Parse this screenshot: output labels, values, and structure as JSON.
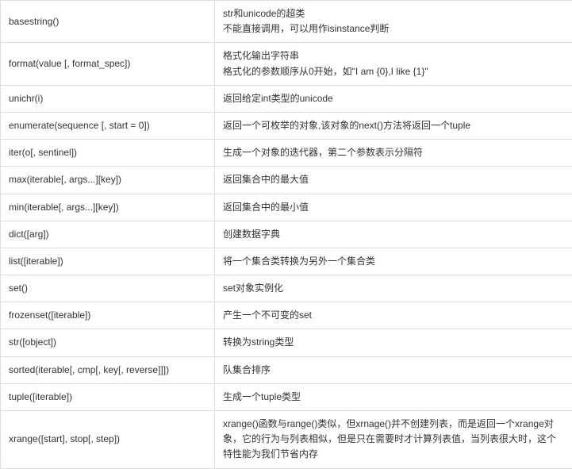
{
  "rows": [
    {
      "func": "basestring()",
      "desc": "str和unicode的超类\n不能直接调用，可以用作isinstance判断"
    },
    {
      "func": "format(value [, format_spec])",
      "desc": "格式化输出字符串\n格式化的参数顺序从0开始，如\"I am {0},I like {1}\""
    },
    {
      "func": "unichr(i)",
      "desc": "返回给定int类型的unicode"
    },
    {
      "func": "enumerate(sequence [, start = 0])",
      "desc": "返回一个可枚举的对象,该对象的next()方法将返回一个tuple"
    },
    {
      "func": "iter(o[, sentinel])",
      "desc": "生成一个对象的迭代器，第二个参数表示分隔符"
    },
    {
      "func": "max(iterable[, args...][key])",
      "desc": "返回集合中的最大值"
    },
    {
      "func": "min(iterable[, args...][key])",
      "desc": "返回集合中的最小值"
    },
    {
      "func": "dict([arg])",
      "desc": "创建数据字典"
    },
    {
      "func": "list([iterable])",
      "desc": "将一个集合类转换为另外一个集合类"
    },
    {
      "func": "set()",
      "desc": "set对象实例化"
    },
    {
      "func": "frozenset([iterable])",
      "desc": "产生一个不可变的set"
    },
    {
      "func": "str([object])",
      "desc": "转换为string类型"
    },
    {
      "func": "sorted(iterable[, cmp[, key[, reverse]]])",
      "desc": "队集合排序"
    },
    {
      "func": "tuple([iterable])",
      "desc": "生成一个tuple类型"
    },
    {
      "func": "xrange([start], stop[, step])",
      "desc": "xrange()函数与range()类似，但xrnage()并不创建列表，而是返回一个xrange对象，它的行为与列表相似，但是只在需要时才计算列表值，当列表很大时，这个特性能为我们节省内存"
    }
  ]
}
